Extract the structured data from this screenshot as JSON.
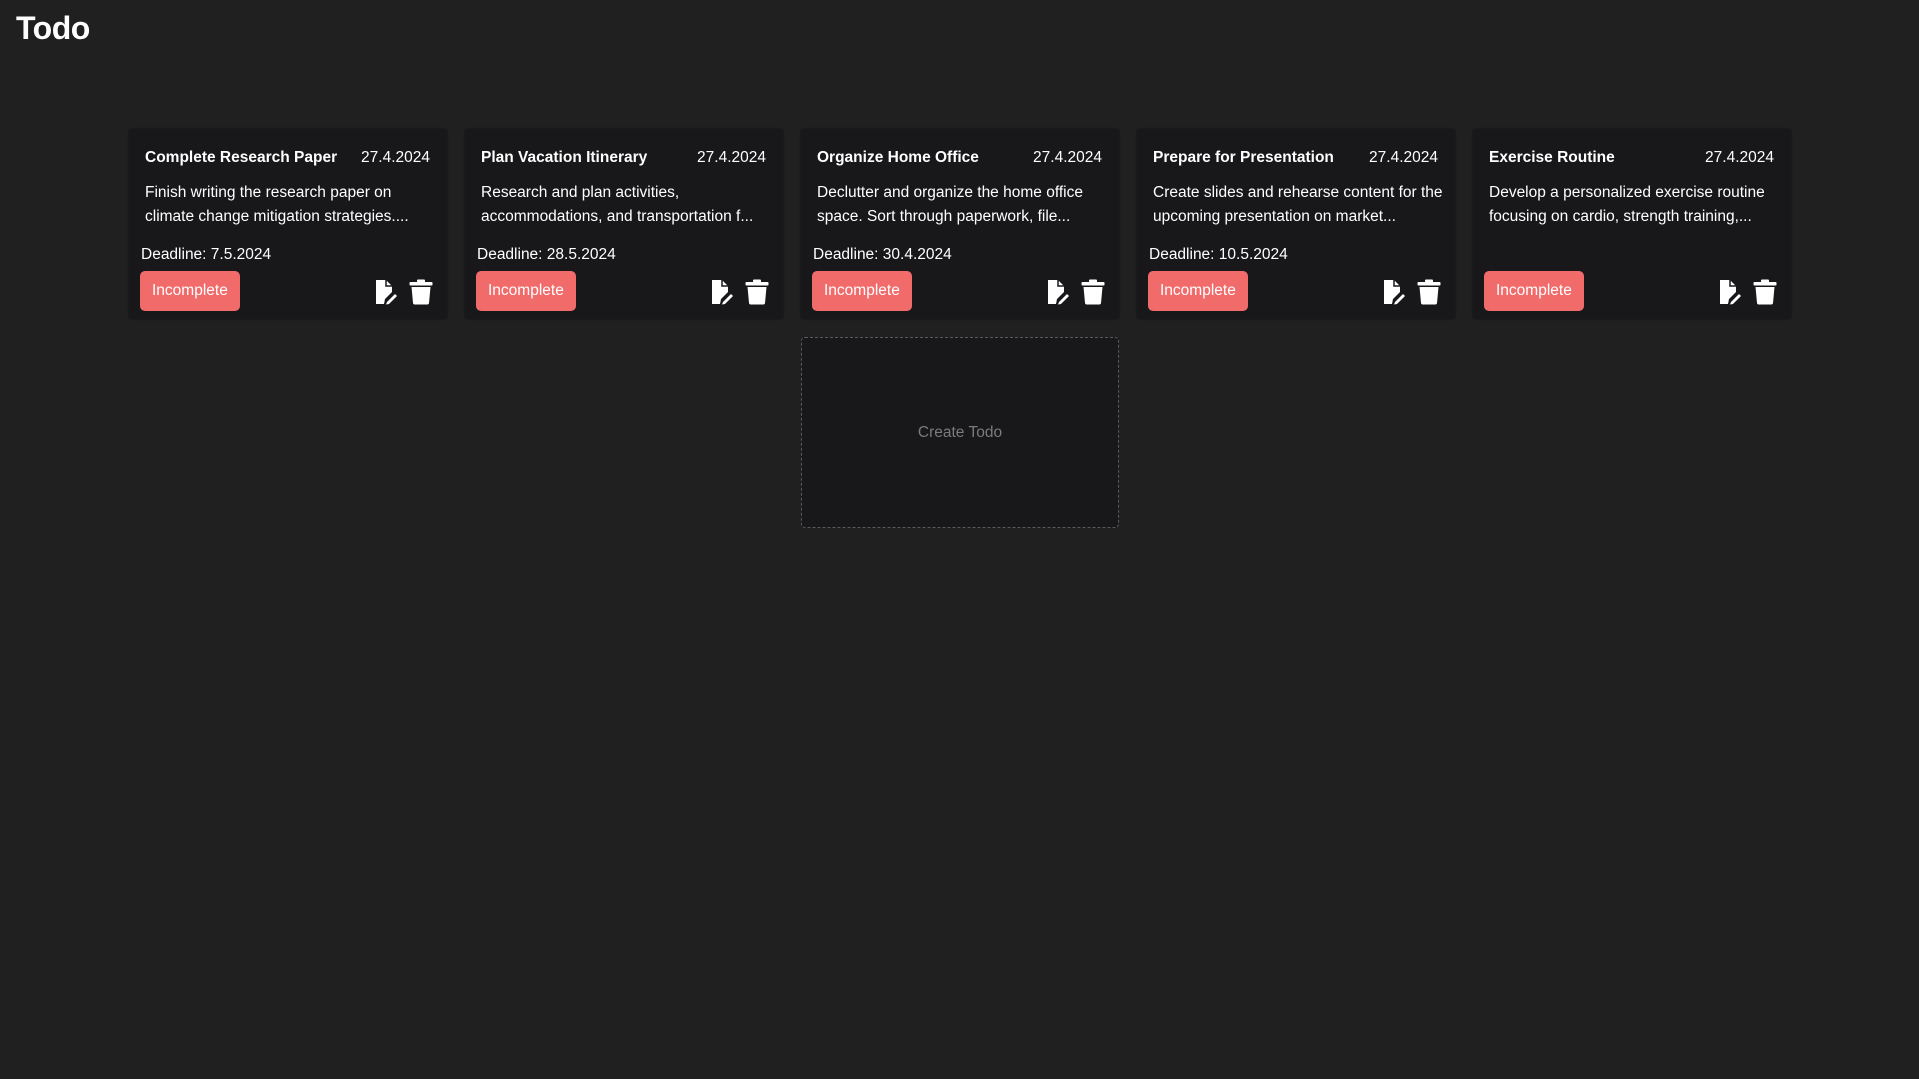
{
  "app": {
    "title": "Todo"
  },
  "todos": [
    {
      "title": "Complete Research Paper",
      "date": "27.4.2024",
      "description": "Finish writing the research paper on climate change mitigation strategies....",
      "deadline": "Deadline: 7.5.2024",
      "status": "Incomplete"
    },
    {
      "title": "Plan Vacation Itinerary",
      "date": "27.4.2024",
      "description": "Research and plan activities, accommodations, and transportation f...",
      "deadline": "Deadline: 28.5.2024",
      "status": "Incomplete"
    },
    {
      "title": "Organize Home Office",
      "date": "27.4.2024",
      "description": "Declutter and organize the home office space. Sort through paperwork, file...",
      "deadline": "Deadline: 30.4.2024",
      "status": "Incomplete"
    },
    {
      "title": "Prepare for Presentation",
      "date": "27.4.2024",
      "description": "Create slides and rehearse content for the upcoming presentation on market...",
      "deadline": "Deadline: 10.5.2024",
      "status": "Incomplete"
    },
    {
      "title": "Exercise Routine",
      "date": "27.4.2024",
      "description": "Develop a personalized exercise routine focusing on cardio, strength training,...",
      "deadline": "",
      "status": "Incomplete"
    }
  ],
  "create": {
    "label": "Create Todo"
  },
  "icons": {
    "edit": "edit-note-icon",
    "delete": "trash-icon"
  },
  "colors": {
    "background": "#202020",
    "card": "#18181a",
    "status_incomplete": "#f26b6b",
    "text": "#ffffff",
    "muted": "#7b7b7b"
  }
}
